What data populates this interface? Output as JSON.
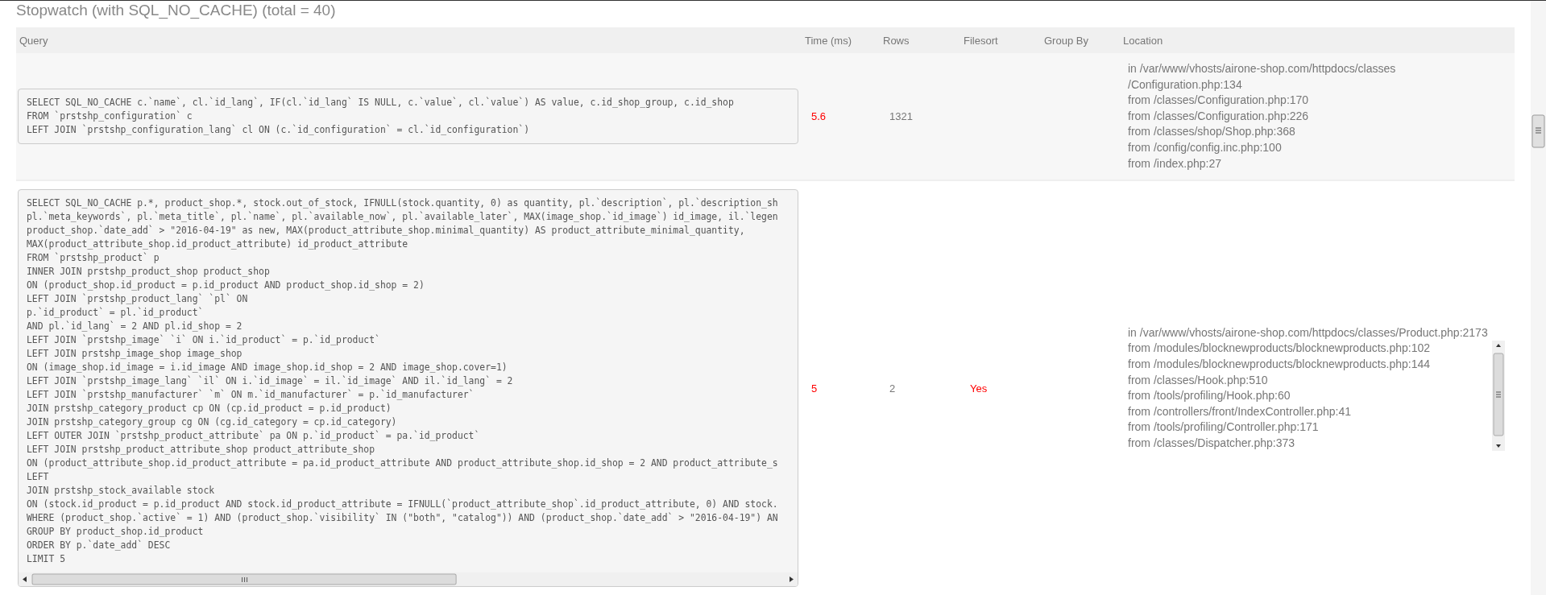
{
  "title": "Stopwatch (with SQL_NO_CACHE) (total = 40)",
  "table": {
    "columns": [
      "Query",
      "Time (ms)",
      "Rows",
      "Filesort",
      "Group By",
      "Location"
    ],
    "rows": [
      {
        "query": [
          "SELECT SQL_NO_CACHE c.`name`, cl.`id_lang`, IF(cl.`id_lang` IS NULL, c.`value`, cl.`value`) AS value, c.id_shop_group, c.id_shop",
          "FROM `prstshp_configuration` c",
          "LEFT JOIN `prstshp_configuration_lang` cl ON (c.`id_configuration` = cl.`id_configuration`)"
        ],
        "query_scroll": false,
        "time": "5.6",
        "rows": "1321",
        "location": [
          "in /var/www/vhosts/airone-shop.com/httpdocs/classes",
          "/Configuration.php:134",
          "from /classes/Configuration.php:170",
          "from /classes/Configuration.php:226",
          "from /classes/shop/Shop.php:368",
          "from /config/config.inc.php:100",
          "from /index.php:27"
        ],
        "location_scroll": false
      },
      {
        "query": [
          "SELECT SQL_NO_CACHE p.*, product_shop.*, stock.out_of_stock, IFNULL(stock.quantity, 0) as quantity, pl.`description`, pl.`description_sh",
          "pl.`meta_keywords`, pl.`meta_title`, pl.`name`, pl.`available_now`, pl.`available_later`, MAX(image_shop.`id_image`) id_image, il.`legen",
          "product_shop.`date_add` > \"2016-04-19\" as new, MAX(product_attribute_shop.minimal_quantity) AS product_attribute_minimal_quantity,",
          "MAX(product_attribute_shop.id_product_attribute) id_product_attribute",
          "FROM `prstshp_product` p",
          "INNER JOIN prstshp_product_shop product_shop",
          "ON (product_shop.id_product = p.id_product AND product_shop.id_shop = 2)",
          "LEFT JOIN `prstshp_product_lang` `pl` ON",
          "p.`id_product` = pl.`id_product`",
          "AND pl.`id_lang` = 2 AND pl.id_shop = 2",
          "LEFT JOIN `prstshp_image` `i` ON i.`id_product` = p.`id_product`",
          "LEFT JOIN prstshp_image_shop image_shop",
          "ON (image_shop.id_image = i.id_image AND image_shop.id_shop = 2 AND image_shop.cover=1)",
          "LEFT JOIN `prstshp_image_lang` `il` ON i.`id_image` = il.`id_image` AND il.`id_lang` = 2",
          "LEFT JOIN `prstshp_manufacturer` `m` ON m.`id_manufacturer` = p.`id_manufacturer`",
          "JOIN prstshp_category_product cp ON (cp.id_product = p.id_product)",
          "JOIN prstshp_category_group cg ON (cg.id_category = cp.id_category)",
          "LEFT OUTER JOIN `prstshp_product_attribute` pa ON p.`id_product` = pa.`id_product`",
          "LEFT JOIN prstshp_product_attribute_shop product_attribute_shop",
          "ON (product_attribute_shop.id_product_attribute = pa.id_product_attribute AND product_attribute_shop.id_shop = 2 AND product_attribute_s",
          "LEFT",
          "JOIN prstshp_stock_available stock",
          "ON (stock.id_product = p.id_product AND stock.id_product_attribute = IFNULL(`product_attribute_shop`.id_product_attribute, 0) AND stock.",
          "WHERE (product_shop.`active` = 1) AND (product_shop.`visibility` IN (\"both\", \"catalog\")) AND (product_shop.`date_add` > \"2016-04-19\") AN",
          "GROUP BY product_shop.id_product",
          "ORDER BY p.`date_add` DESC",
          "LIMIT 5"
        ],
        "query_scroll": true,
        "time": "5",
        "rows": "2",
        "filesort": "Yes",
        "location": [
          "in /var/www/vhosts/airone-shop.com/httpdocs/classes/Product.php:2173",
          "from /modules/blocknewproducts/blocknewproducts.php:102",
          "from /modules/blocknewproducts/blocknewproducts.php:144",
          "from /classes/Hook.php:510",
          "from /tools/profiling/Hook.php:60",
          "from /controllers/front/IndexController.php:41",
          "from /tools/profiling/Controller.php:171",
          "from /classes/Dispatcher.php:373"
        ],
        "location_scroll": true
      }
    ]
  }
}
